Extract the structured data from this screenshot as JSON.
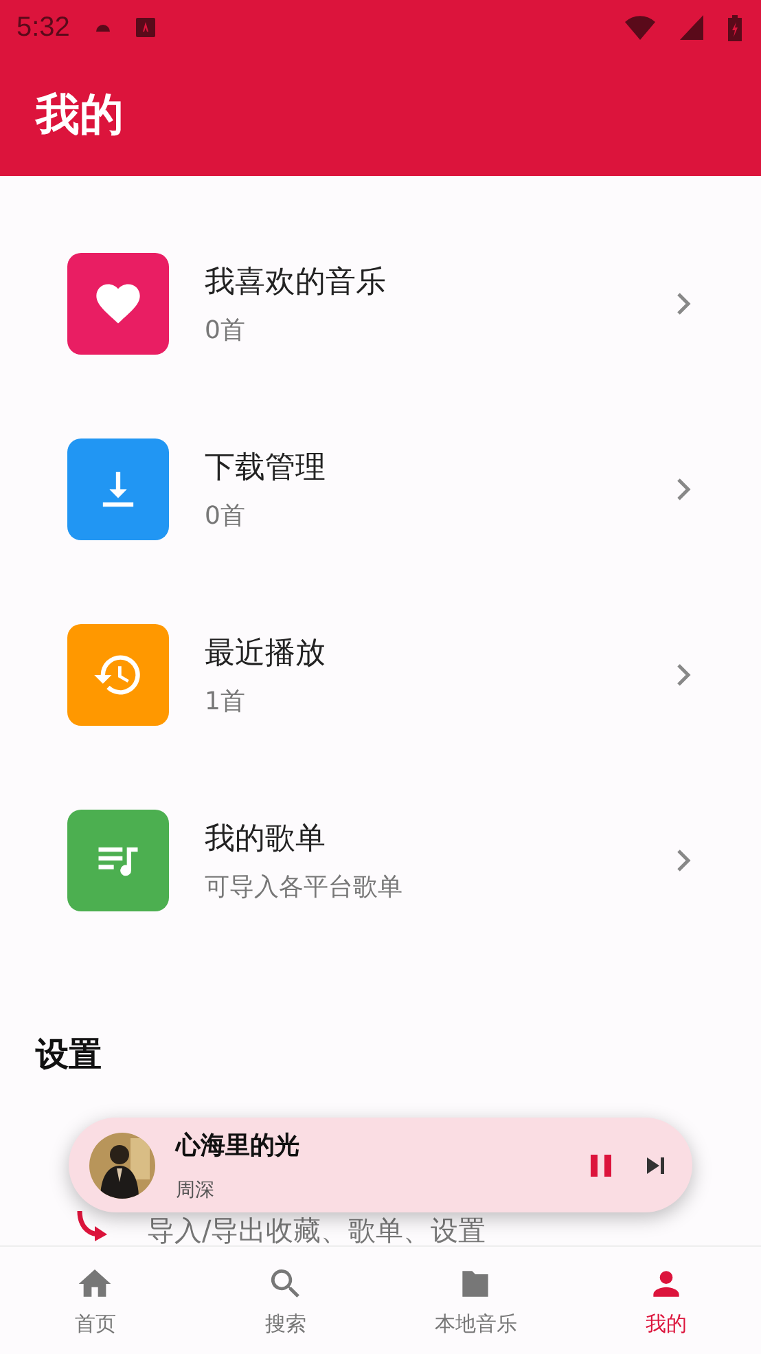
{
  "status_bar": {
    "time": "5:32"
  },
  "app_bar": {
    "title": "我的"
  },
  "items": [
    {
      "kind": "heart",
      "color": "#e91e63",
      "title": "我喜欢的音乐",
      "subtitle": "0首"
    },
    {
      "kind": "download",
      "color": "#2196f3",
      "title": "下载管理",
      "subtitle": "0首"
    },
    {
      "kind": "history",
      "color": "#ff9800",
      "title": "最近播放",
      "subtitle": "1首"
    },
    {
      "kind": "playlist",
      "color": "#4caf50",
      "title": "我的歌单",
      "subtitle": "可导入各平台歌单"
    }
  ],
  "settings": {
    "heading": "设置",
    "items": [
      {
        "kind": "sync",
        "subtitle": "导入/导出收藏、歌单、设置"
      }
    ]
  },
  "mini_player": {
    "title": "心海里的光",
    "artist": "周深",
    "playing": true
  },
  "bottom_nav": [
    {
      "kind": "home",
      "label": "首页",
      "selected": false
    },
    {
      "kind": "search",
      "label": "搜索",
      "selected": false
    },
    {
      "kind": "folder",
      "label": "本地音乐",
      "selected": false
    },
    {
      "kind": "person",
      "label": "我的",
      "selected": true
    }
  ]
}
